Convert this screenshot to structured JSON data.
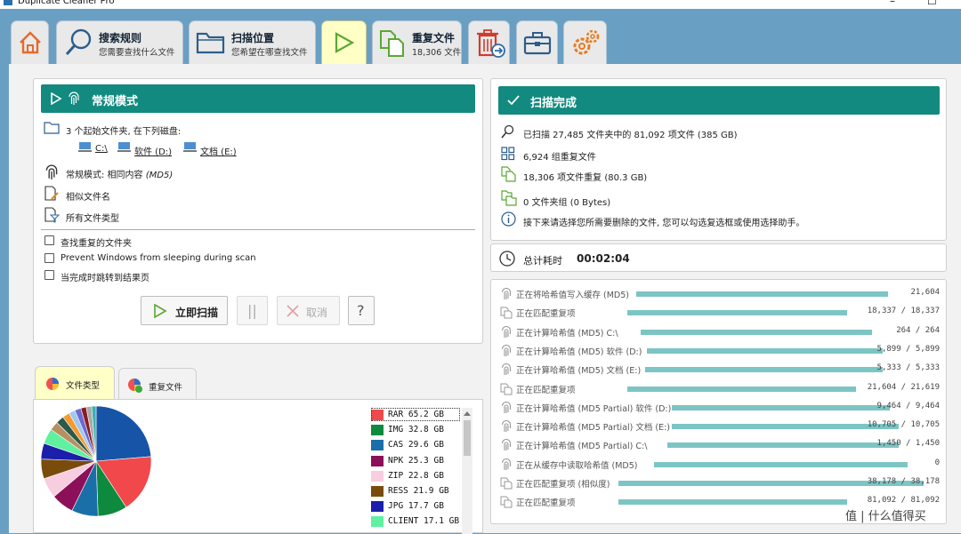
{
  "window": {
    "title": "Duplicate Cleaner Pro",
    "minimize": "–",
    "maximize": "☐"
  },
  "tabs": [
    {
      "icon": "home-icon"
    },
    {
      "icon": "search-icon",
      "title": "搜索规则",
      "subtitle": "您需要查找什么文件"
    },
    {
      "icon": "folder-icon",
      "title": "扫描位置",
      "subtitle": "您希望在哪查找文件"
    },
    {
      "icon": "play-icon",
      "active": true
    },
    {
      "icon": "duplicate-files-icon",
      "title": "重复文件",
      "subtitle": "18,306 文件"
    },
    {
      "icon": "trash-move-icon"
    },
    {
      "icon": "toolbox-icon"
    },
    {
      "icon": "gears-icon"
    }
  ],
  "mode_panel": {
    "header": "常规模式",
    "folders_text": "3 个起始文件夹, 在下列磁盘:",
    "drives": [
      "C:\\",
      "软件 (D:)",
      "文档 (E:)"
    ],
    "mode_line_prefix": "常规模式: 相同内容 ",
    "mode_line_algo": "(MD5)",
    "similar_names": "相似文件名",
    "all_types": "所有文件类型",
    "options": [
      {
        "label": "查找重复的文件夹",
        "checked": false
      },
      {
        "label": "Prevent Windows from sleeping during scan",
        "checked": false
      },
      {
        "label": "当完成时跳转到结果页",
        "checked": false
      }
    ],
    "buttons": {
      "scan": "立即扫描",
      "pause": "||",
      "cancel": "取消",
      "help": "?"
    }
  },
  "scan_complete": {
    "header": "扫描完成",
    "scanned": "已扫描 27,485 文件夹中的 81,092 项文件 (385 GB)",
    "groups": "6,924 组重复文件",
    "dup_files": "18,306 项文件重复 (80.3 GB)",
    "folder_groups": "0 文件夹组 (0 Bytes)",
    "hint": "接下来请选择您所需要删除的文件, 您可以勾选复选框或使用选择助手。"
  },
  "time": {
    "label": "总计耗时",
    "value": "00:02:04"
  },
  "progress": [
    {
      "icon": "fingerprint-icon",
      "label": "正在将哈希值写入缓存 (MD5)",
      "count": "21,604",
      "fraction": 1.0
    },
    {
      "icon": "copy-icon",
      "label": "正在匹配重复项",
      "count": "18,337 / 18,337",
      "fraction": 1.0
    },
    {
      "icon": "fingerprint-icon",
      "label": "正在计算哈希值 (MD5) C:\\",
      "count": "264 / 264",
      "fraction": 1.0
    },
    {
      "icon": "fingerprint-icon",
      "label": "正在计算哈希值 (MD5) 软件 (D:)",
      "count": "5,899 / 5,899",
      "fraction": 1.0
    },
    {
      "icon": "fingerprint-icon",
      "label": "正在计算哈希值 (MD5) 文档 (E:)",
      "count": "5,333 / 5,333",
      "fraction": 1.0
    },
    {
      "icon": "copy-icon",
      "label": "正在匹配重复项",
      "count": "21,604 / 21,619",
      "fraction": 1.0
    },
    {
      "icon": "fingerprint-icon",
      "label": "正在计算哈希值 (MD5 Partial) 软件 (D:)",
      "count": "9,464 / 9,464",
      "fraction": 1.0
    },
    {
      "icon": "fingerprint-icon",
      "label": "正在计算哈希值 (MD5 Partial) 文档 (E:)",
      "count": "10,705 / 10,705",
      "fraction": 1.0
    },
    {
      "icon": "fingerprint-icon",
      "label": "正在计算哈希值 (MD5 Partial) C:\\",
      "count": "1,450 / 1,450",
      "fraction": 1.0
    },
    {
      "icon": "fingerprint-icon",
      "label": "正在从缓存中读取哈希值 (MD5)",
      "count": "0",
      "fraction": 1.0
    },
    {
      "icon": "copy-icon",
      "label": "正在匹配重复项 (相似度)",
      "count": "38,178 / 38,178",
      "fraction": 1.0
    },
    {
      "icon": "copy-icon",
      "label": "正在匹配重复项",
      "count": "81,092 / 81,092",
      "fraction": 1.0
    }
  ],
  "chart_tabs": [
    {
      "label": "文件类型",
      "active": true
    },
    {
      "label": "重复文件",
      "active": false
    }
  ],
  "chart_data": {
    "type": "pie",
    "title": "",
    "slices": [
      {
        "label": "RAR",
        "value": 65.2,
        "unit": "GB",
        "color": "#f0484b"
      },
      {
        "label": "IMG",
        "value": 32.8,
        "unit": "GB",
        "color": "#0e8a3e"
      },
      {
        "label": "CAS",
        "value": 29.6,
        "unit": "GB",
        "color": "#1a6fa8"
      },
      {
        "label": "NPK",
        "value": 25.3,
        "unit": "GB",
        "color": "#8c0f5a"
      },
      {
        "label": "ZIP",
        "value": 22.8,
        "unit": "GB",
        "color": "#f9cde0"
      },
      {
        "label": "RESS",
        "value": 21.9,
        "unit": "GB",
        "color": "#7a4c0c"
      },
      {
        "label": "JPG",
        "value": 17.7,
        "unit": "GB",
        "color": "#1b1faa"
      },
      {
        "label": "CLIENT",
        "value": 17.1,
        "unit": "GB",
        "color": "#5ff0a0"
      }
    ],
    "extra_slices": [
      {
        "value": 10,
        "color": "#b89060"
      },
      {
        "value": 9,
        "color": "#2a5a4a"
      },
      {
        "value": 8,
        "color": "#f59a30"
      },
      {
        "value": 7,
        "color": "#9fc7f0"
      },
      {
        "value": 7,
        "color": "#6b6bd0"
      },
      {
        "value": 6,
        "color": "#8a1c20"
      },
      {
        "value": 6,
        "color": "#aaaaaa"
      },
      {
        "value": 5,
        "color": "#3ab0b0"
      }
    ],
    "big_slice": {
      "value": 90,
      "color": "#1654a8"
    },
    "legend_visible": [
      "RAR 65.2 GB",
      "IMG 32.8 GB",
      "CAS 29.6 GB",
      "NPK 25.3 GB",
      "ZIP 22.8 GB",
      "RESS 21.9 GB",
      "JPG 17.7 GB",
      "CLIENT 17.1 GB"
    ]
  },
  "watermark": "值 | 什么值得买"
}
